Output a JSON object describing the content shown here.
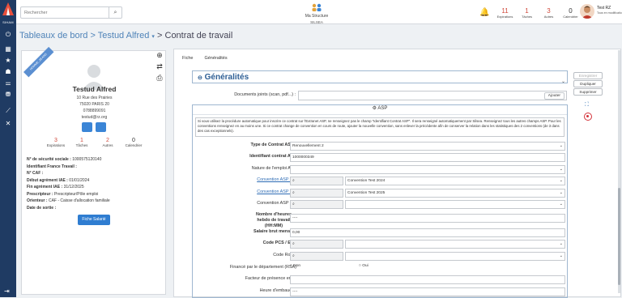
{
  "rail": {
    "brand": "SIHAM",
    "icons": [
      "home-icon",
      "dashboard-icon",
      "star-icon",
      "people-icon",
      "briefcase-icon",
      "report-icon",
      "chart-icon",
      "tools-icon"
    ],
    "logout_icon": "logout-icon"
  },
  "search": {
    "placeholder": "Rechercher"
  },
  "structure": {
    "label": "Ma Structure",
    "name": "SILSEA"
  },
  "counters": [
    {
      "value": "11",
      "label": "Expirations"
    },
    {
      "value": "1",
      "label": "Tâches"
    },
    {
      "value": "3",
      "label": "Autres"
    },
    {
      "value": "0",
      "label": "Calendrier"
    }
  ],
  "user": {
    "name": "Test RZ",
    "role": "Tous en modification"
  },
  "breadcrumb": {
    "part1": "Tableaux de bord",
    "sep1": ">",
    "part2": "Testud Alfred",
    "dropdown": "▾",
    "sep2": ">",
    "part3": "Contrat de travail"
  },
  "profile": {
    "ribbon": "HOMME, 28 ANS",
    "name": "Testud Alfred",
    "address1": "10 Rue des Prairies",
    "address2": "75020 PARIS 20",
    "phone": "0788899091",
    "email": "testud@rz.org",
    "kpis": [
      {
        "value": "3",
        "label": "Expirations"
      },
      {
        "value": "1",
        "label": "Tâches"
      },
      {
        "value": "2",
        "label": "Autres"
      },
      {
        "value": "0",
        "label": "Calendrier"
      }
    ],
    "info": [
      {
        "label": "N° de sécurité sociale :",
        "value": "1000575120140"
      },
      {
        "label": "Identifiant France Travail :",
        "value": ""
      },
      {
        "label": "N° CAF :",
        "value": ""
      },
      {
        "label": "Début agrément IAE :",
        "value": "01/01/2024"
      },
      {
        "label": "Fin agrément IAE :",
        "value": "31/12/2025"
      },
      {
        "label": "Prescripteur :",
        "value": "Prescripteur/Pôle emploi"
      },
      {
        "label": "Orienteur :",
        "value": "CAF - Caisse d'allocation familiale"
      },
      {
        "label": "Date de sortie :",
        "value": ""
      }
    ],
    "button": "Fiche Salarié"
  },
  "tabs": [
    "Fiche",
    "Généralités"
  ],
  "section_title": "Généralités",
  "docs": {
    "label": "Documents joints (scan, pdf...) :",
    "button": "Ajouter"
  },
  "asp": {
    "title": "ASP",
    "note": "Si vous utilisez la procédure automatique pour inscrire ce contrat sur l'Extranet ASP, ne renseignez pas le champ \"Identifiant Contrat ASP\". Il sera renseigné automatiquement par Silsea. Renseignez tous les autres champs ASP. Pour les conventions renseignez en au moins une. Si ce contrat change de convention en cours de route, ajouter la nouvelle convention, sans enlever la précédente afin de conserver la relation dans les statistiques des 2 conventions (de 3 dans des cas exceptionnels).",
    "type_label": "Type de Contrat ASP *",
    "type_value": "Renouvellement 2",
    "id_label": "Identifiant contrat ASP",
    "id_value": "1000000349",
    "nature_label": "Nature de l'emploi ASP",
    "conv1_label": "Convention ASP n°1",
    "conv1_value": "Convention Test 2024",
    "conv2_label": "Convention ASP n°2",
    "conv2_value": "Convention Test 2025",
    "conv3_label": "Convention ASP n°3",
    "hours_label": "Nombre d'heures hebdo de travail (HH:MM)",
    "hours_value": "----",
    "salary_label": "Salaire brut mensuel",
    "salary_value": "0,00",
    "pcs_label": "Code PCS / ESE",
    "rome_label": "Code Rome",
    "finance_label": "Financé par le département (RSA)",
    "no_label": "Non",
    "yes_label": "Oui",
    "presence_label": "Facteur de présence en %",
    "hire_label": "Heure d'embauche",
    "hire_value": "----"
  },
  "actions": {
    "save": "Enregistrer",
    "duplicate": "Dupliquer",
    "delete": "Supprimer"
  }
}
